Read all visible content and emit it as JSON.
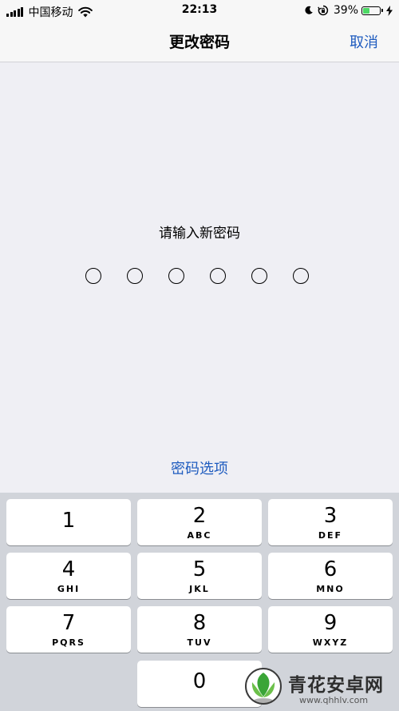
{
  "status_bar": {
    "carrier": "中国移动",
    "time": "22:13",
    "battery_percent": "39%",
    "battery_level": 0.39
  },
  "nav": {
    "title": "更改密码",
    "cancel_label": "取消"
  },
  "prompt": "请输入新密码",
  "passcode_length": 6,
  "options_label": "密码选项",
  "keypad": {
    "keys": [
      {
        "number": "1",
        "letters": ""
      },
      {
        "number": "2",
        "letters": "ABC"
      },
      {
        "number": "3",
        "letters": "DEF"
      },
      {
        "number": "4",
        "letters": "GHI"
      },
      {
        "number": "5",
        "letters": "JKL"
      },
      {
        "number": "6",
        "letters": "MNO"
      },
      {
        "number": "7",
        "letters": "PQRS"
      },
      {
        "number": "8",
        "letters": "TUV"
      },
      {
        "number": "9",
        "letters": "WXYZ"
      },
      {
        "number": "0",
        "letters": ""
      }
    ]
  },
  "watermark": {
    "name": "青花安卓网",
    "url": "www.qhhlv.com"
  },
  "colors": {
    "accent": "#1f5cbf",
    "background": "#efeff4",
    "keypad_background": "#d1d4da",
    "battery_fill": "#4cd964"
  }
}
